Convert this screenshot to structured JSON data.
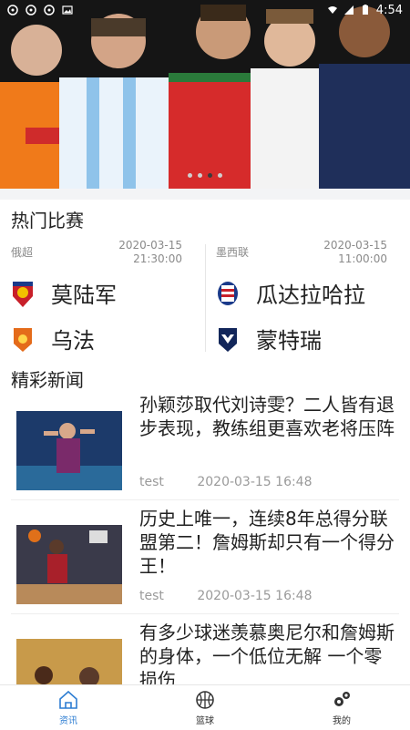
{
  "status_bar": {
    "time": "4:54"
  },
  "banner": {
    "slides": 4,
    "active_slide": 2
  },
  "sections": {
    "hot_matches_title": "热门比赛",
    "news_title": "精彩新闻"
  },
  "matches": [
    {
      "league": "俄超",
      "date": "2020-03-15",
      "time": "21:30:00",
      "home": "莫陆军",
      "away": "乌法"
    },
    {
      "league": "墨西联",
      "date": "2020-03-15",
      "time": "11:00:00",
      "home": "瓜达拉哈拉",
      "away": "蒙特瑞"
    }
  ],
  "news": [
    {
      "title": "孙颖莎取代刘诗雯？二人皆有退步表现，教练组更喜欢老将压阵",
      "author": "test",
      "datetime": "2020-03-15 16:48"
    },
    {
      "title": "历史上唯一，连续8年总得分联盟第二！詹姆斯却只有一个得分王！",
      "author": "test",
      "datetime": "2020-03-15 16:48"
    },
    {
      "title": "有多少球迷羡慕奥尼尔和詹姆斯的身体，一个低位无解 一个零损伤",
      "author": "",
      "datetime": ""
    }
  ],
  "tabs": [
    {
      "label": "资讯",
      "icon": "home-icon"
    },
    {
      "label": "篮球",
      "icon": "basketball-icon"
    },
    {
      "label": "我的",
      "icon": "gears-icon"
    }
  ],
  "colors": {
    "tab_active": "#2d7dd2",
    "muted_text": "#8a8a8a",
    "divider": "#eeeeee"
  }
}
